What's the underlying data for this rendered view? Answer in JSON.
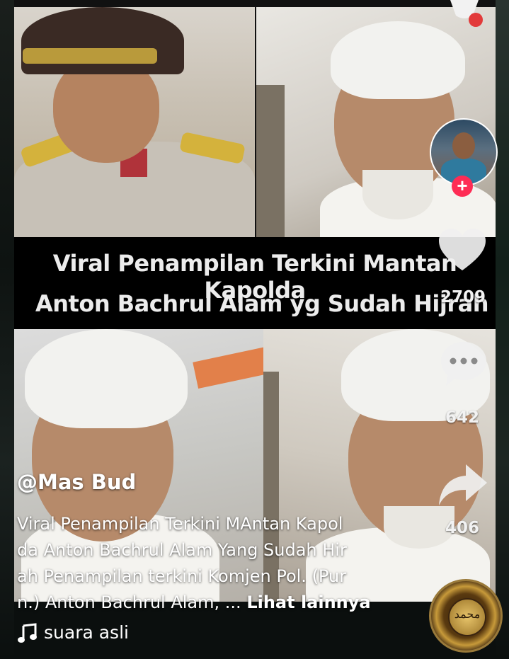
{
  "overlay_title": {
    "line1": "Viral Penampilan Terkini Mantan Kapolda",
    "line2": "Anton Bachrul Alam yg Sudah Hijrah"
  },
  "rail": {
    "likes": "2709",
    "comments": "642",
    "shares": "406"
  },
  "post": {
    "author": "@Mas Bud",
    "description_lines": [
      "Viral Penampilan Terkini MAntan Kapol",
      "da Anton Bachrul Alam Yang Sudah Hir",
      "ah Penampilan terkini Komjen Pol. (Pur",
      "n.) Anton Bachrul Alam, ..."
    ],
    "see_more": "Lihat lainnya"
  },
  "sound": {
    "label": "suara asli"
  },
  "disc": {
    "emblem_text": "محمد"
  },
  "colors": {
    "accent": "#fe2c55",
    "title_band": "#000000",
    "text": "#ffffff"
  },
  "icons": [
    "heart-icon",
    "comment-icon",
    "share-icon",
    "plus-icon",
    "music-note-icon"
  ]
}
